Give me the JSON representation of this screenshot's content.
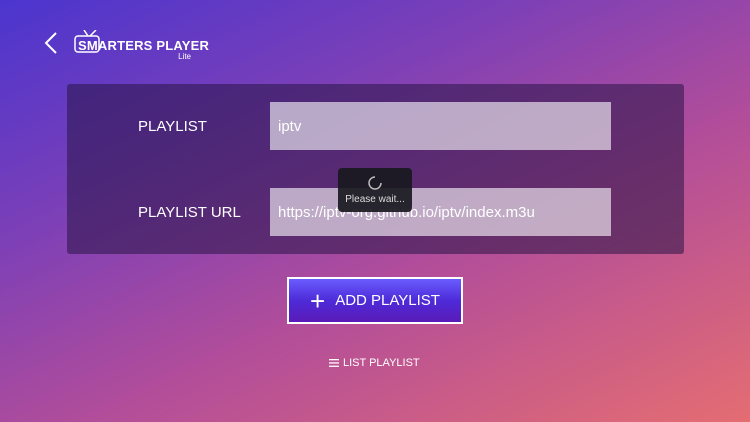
{
  "logo": {
    "title": "SMARTERS PLAYER",
    "subtitle": "Lite"
  },
  "form": {
    "playlist_label": "PLAYLIST",
    "playlist_value": "iptv",
    "url_label": "PLAYLIST URL",
    "url_value": "https://iptv-org.github.io/iptv/index.m3u"
  },
  "loading": {
    "text": "Please wait..."
  },
  "actions": {
    "add_playlist_label": "ADD PLAYLIST",
    "list_playlist_label": "LIST PLAYLIST"
  },
  "icons": [
    "back-icon",
    "tv-icon",
    "spinner-icon",
    "plus-icon",
    "menu-icon"
  ]
}
